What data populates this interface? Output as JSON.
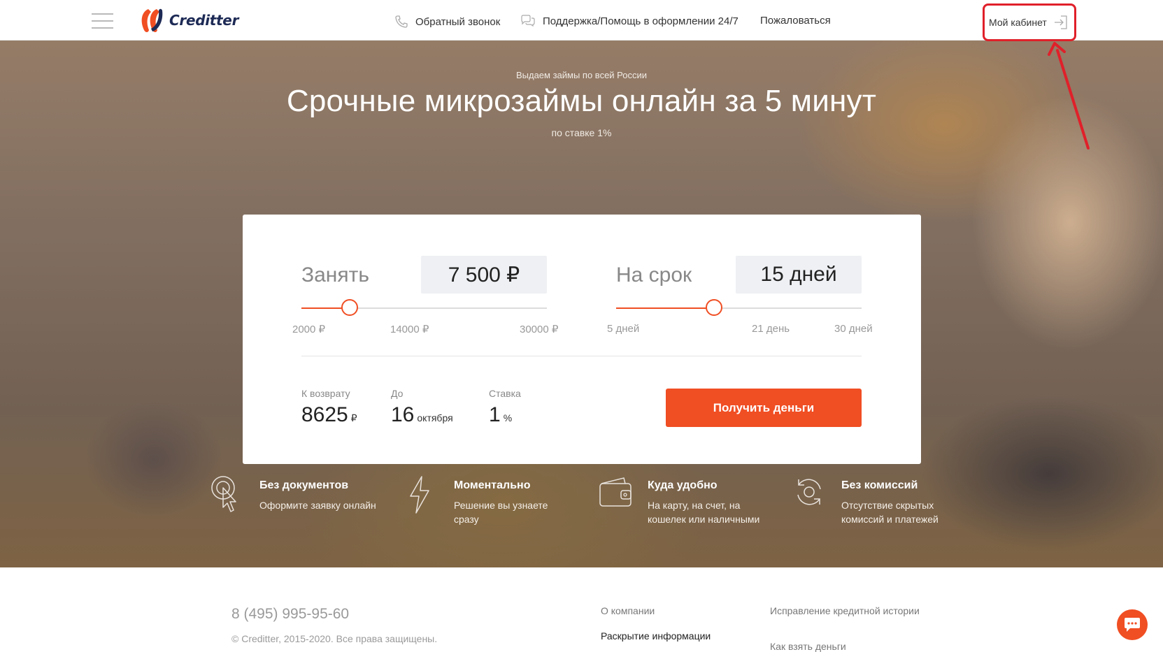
{
  "header": {
    "logo_text": "Creditter",
    "nav": [
      {
        "label": "Обратный звонок",
        "icon": "phone-icon"
      },
      {
        "label": "Поддержка/Помощь в оформлении 24/7",
        "icon": "chat-bubbles-icon"
      },
      {
        "label": "Пожаловаться"
      }
    ],
    "cabinet_label": "Мой кабинет"
  },
  "hero": {
    "subtitle": "Выдаем займы по всей России",
    "title": "Срочные микрозаймы онлайн за 5 минут",
    "rate_note": "по ставке 1%"
  },
  "calculator": {
    "amount": {
      "label": "Занять",
      "value": "7 500 ₽",
      "ticks": [
        "2000 ₽",
        "14000 ₽",
        "30000 ₽"
      ],
      "min": 2000,
      "max": 30000,
      "current": 7500
    },
    "term": {
      "label": "На срок",
      "value": "15 дней",
      "ticks": [
        "5 дней",
        "21 день",
        "30 дней"
      ],
      "min": 5,
      "max": 30,
      "current": 15
    },
    "summary": {
      "repay_label": "К возврату",
      "repay_value": "8625",
      "repay_unit": "₽",
      "due_label": "До",
      "due_day": "16",
      "due_month": "октября",
      "rate_label": "Ставка",
      "rate_value": "1",
      "rate_unit": "%"
    },
    "cta_label": "Получить деньги"
  },
  "features": [
    {
      "title": "Без документов",
      "desc": "Оформите заявку онлайн",
      "icon": "touch-click-icon"
    },
    {
      "title": "Моментально",
      "desc": "Решение вы узнаете сразу",
      "icon": "lightning-icon"
    },
    {
      "title": "Куда удобно",
      "desc": "На карту, на счет, на кошелек или наличными",
      "icon": "wallet-icon"
    },
    {
      "title": "Без комиссий",
      "desc": "Отсутствие скрытых комиссий и платежей",
      "icon": "refresh-icon"
    }
  ],
  "footer": {
    "phone": "8 (495) 995-95-60",
    "copyright": "© Creditter, 2015-2020. Все права защищены.",
    "links_col1": [
      "О компании",
      "Раскрытие информации"
    ],
    "links_col2": [
      "Исправление кредитной истории",
      "Как взять деньги"
    ]
  },
  "colors": {
    "accent": "#f04e23",
    "annotation": "#e0202a",
    "brand_dark": "#1d2a55"
  }
}
